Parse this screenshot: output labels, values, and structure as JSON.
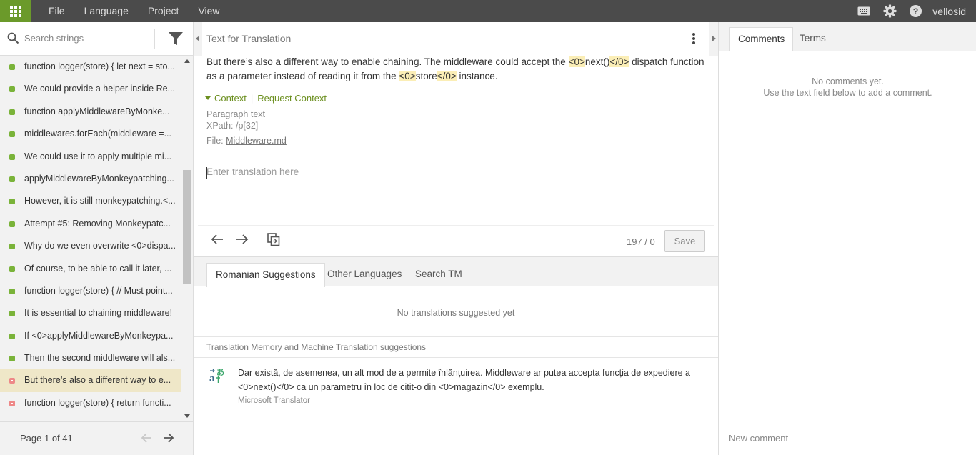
{
  "topbar": {
    "menu": [
      "File",
      "Language",
      "Project",
      "View"
    ],
    "username": "vellosid"
  },
  "sidebar": {
    "search_placeholder": "Search strings",
    "strings": [
      {
        "text": "function logger(store) { let next = sto...",
        "status": "translated"
      },
      {
        "text": "We could provide a helper inside Re...",
        "status": "translated"
      },
      {
        "text": "function applyMiddlewareByMonke...",
        "status": "translated"
      },
      {
        "text": "middlewares.forEach(middleware =...",
        "status": "translated"
      },
      {
        "text": "We could use it to apply multiple mi...",
        "status": "translated"
      },
      {
        "text": "applyMiddlewareByMonkeypatching...",
        "status": "translated"
      },
      {
        "text": "However, it is still monkeypatching.<...",
        "status": "translated"
      },
      {
        "text": "Attempt #5: Removing Monkeypatc...",
        "status": "translated"
      },
      {
        "text": "Why do we even overwrite <0>dispa...",
        "status": "translated"
      },
      {
        "text": "Of course, to be able to call it later, ...",
        "status": "translated"
      },
      {
        "text": "function logger(store) { // Must point...",
        "status": "translated"
      },
      {
        "text": "It is essential to chaining middleware!",
        "status": "translated"
      },
      {
        "text": "If <0>applyMiddlewareByMonkeypa...",
        "status": "translated"
      },
      {
        "text": "Then the second middleware will als...",
        "status": "translated"
      },
      {
        "text": "But there’s also a different way to e...",
        "status": "untranslated",
        "selected": true
      },
      {
        "text": "function logger(store) { return functi...",
        "status": "untranslated"
      },
      {
        "text": "Ideas & (previously: the core ..",
        "status": "untranslated"
      }
    ],
    "pager": "Page 1 of 41"
  },
  "editor": {
    "title": "Text for Translation",
    "source_parts": [
      {
        "t": "But there’s also a different way to enable chaining. The middleware could accept the "
      },
      {
        "t": "<0>",
        "tag": true
      },
      {
        "t": "next()"
      },
      {
        "t": "</0>",
        "tag": true
      },
      {
        "t": " dispatch function as a parameter instead of reading it from the "
      },
      {
        "t": "<0>",
        "tag": true
      },
      {
        "t": "store"
      },
      {
        "t": "</0>",
        "tag": true
      },
      {
        "t": " instance."
      }
    ],
    "context_label": "Context",
    "request_context_label": "Request Context",
    "paragraph_label": "Paragraph text",
    "xpath": "XPath: /p[32]",
    "file_label": "File: ",
    "file_name": "Middleware.md",
    "translation_placeholder": "Enter translation here",
    "count": "197 / 0",
    "save_label": "Save"
  },
  "suggestions": {
    "tabs": [
      "Romanian Suggestions",
      "Other Languages",
      "Search TM"
    ],
    "empty": "No translations suggested yet",
    "tm_header": "Translation Memory and Machine Translation suggestions",
    "mt_text": "Dar există, de asemenea, un alt mod de a permite înlănțuirea. Middleware ar putea accepta funcția de expediere a <0>next()</0> ca un parametru în loc de citit-o din <0>magazin</0> exemplu.",
    "mt_source": "Microsoft Translator"
  },
  "comments": {
    "tabs": [
      "Comments",
      "Terms"
    ],
    "empty_line1": "No comments yet.",
    "empty_line2": "Use the text field below to add a comment.",
    "new_comment_placeholder": "New comment"
  },
  "colors": {
    "accent": "#6b9a2a",
    "topbar": "#4b4b4b",
    "translated": "#7ab339",
    "untranslated": "#e88888",
    "selected_row": "#efe7c8",
    "tag_highlight": "#fbeeb6"
  },
  "icons": [
    "apps-grid-icon",
    "keyboard-icon",
    "settings-gear-icon",
    "help-icon",
    "search-icon",
    "filter-icon",
    "arrow-left-icon",
    "arrow-right-icon",
    "copy-source-icon",
    "kebab-menu-icon",
    "machine-translation-icon"
  ]
}
